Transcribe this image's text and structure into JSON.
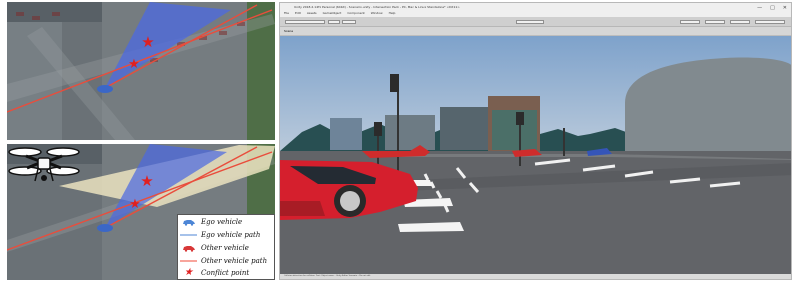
{
  "legend": {
    "items": [
      {
        "label": "Ego vehicle"
      },
      {
        "label": "Ego vehicle path"
      },
      {
        "label": "Other vehicle"
      },
      {
        "label": "Other vehicle path"
      },
      {
        "label": "Conflict point"
      }
    ]
  },
  "editor": {
    "title": "Unity 2018.2.14f1 Personal (64bit) - Scenario.unity - Intersection Pack - PC, Mac & Linux Standalone* <DX11>",
    "menu": [
      "File",
      "Edit",
      "Assets",
      "GameObject",
      "Component",
      "Window",
      "Help"
    ],
    "window_controls": [
      "—",
      "□",
      "✕"
    ],
    "scene_tab": "Scene",
    "status": "Collision detection for collision. Text: Object mass... Unity Editor Scenario - Do not edit"
  },
  "colors": {
    "ego_vehicle": "#4d86d6",
    "other_vehicle": "#d83838",
    "path": "#f04b3a",
    "conflict": "#e02020",
    "fov": "#5368df",
    "drone_fov": "#efe7c2"
  }
}
